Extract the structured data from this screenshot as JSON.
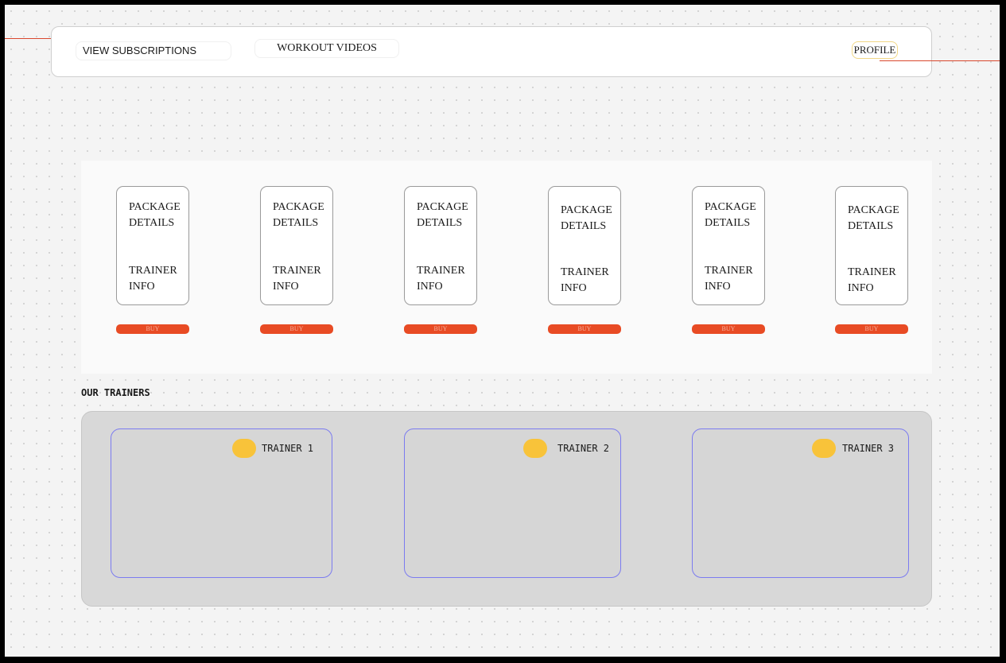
{
  "nav": {
    "view_subscriptions": "VIEW SUBSCRIPTIONS",
    "workout_videos": "WORKOUT VIDEOS",
    "profile": "PROFILE"
  },
  "packages": [
    {
      "details": "PACKAGE DETAILS",
      "trainer_info": "TRAINER INFO",
      "buy": "BUY"
    },
    {
      "details": "PACKAGE DETAILS",
      "trainer_info": "TRAINER INFO",
      "buy": "BUY"
    },
    {
      "details": "PACKAGE DETAILS",
      "trainer_info": "TRAINER INFO",
      "buy": "BUY"
    },
    {
      "details": "PACKAGE DETAILS",
      "trainer_info": "TRAINER INFO",
      "buy": "BUY"
    },
    {
      "details": "PACKAGE DETAILS",
      "trainer_info": "TRAINER INFO",
      "buy": "BUY"
    },
    {
      "details": "PACKAGE DETAILS",
      "trainer_info": "TRAINER INFO",
      "buy": "BUY"
    }
  ],
  "trainers_section": {
    "heading": "OUR TRAINERS",
    "trainers": [
      {
        "name": "TRAINER 1"
      },
      {
        "name": "TRAINER 2"
      },
      {
        "name": "TRAINER 3"
      }
    ]
  },
  "colors": {
    "accent_buy": "#e84b24",
    "avatar": "#f8c33a",
    "trainer_card_border": "#7b7bf0",
    "annotation_line": "#d9482e"
  }
}
